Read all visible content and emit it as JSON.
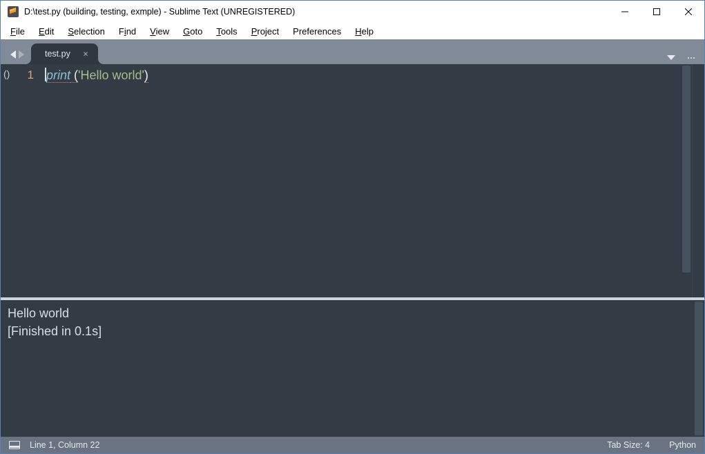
{
  "window": {
    "title": "D:\\test.py (building, testing, exmple) - Sublime Text (UNREGISTERED)"
  },
  "menu": {
    "items": [
      {
        "key": "F",
        "rest": "ile"
      },
      {
        "key": "E",
        "rest": "dit"
      },
      {
        "key": "S",
        "rest": "election"
      },
      {
        "key": "",
        "rest": "F",
        "key2": "i",
        "rest2": "nd"
      },
      {
        "key": "V",
        "rest": "iew"
      },
      {
        "key": "G",
        "rest": "oto"
      },
      {
        "key": "T",
        "rest": "ools"
      },
      {
        "key": "P",
        "rest": "roject"
      },
      {
        "key": "",
        "rest": "Preferences"
      },
      {
        "key": "H",
        "rest": "elp"
      }
    ]
  },
  "tabs": {
    "active": {
      "label": "test.py"
    }
  },
  "editor": {
    "gutter_fold": "()",
    "line_number": "1",
    "tokens": {
      "func": "print",
      "open_paren_with_space": " (",
      "string": "'Hello world'",
      "close_paren": ")"
    }
  },
  "output": {
    "lines": [
      "Hello world",
      "[Finished in 0.1s]"
    ]
  },
  "status": {
    "position": "Line 1, Column 22",
    "tab_size": "Tab Size: 4",
    "syntax": "Python"
  }
}
